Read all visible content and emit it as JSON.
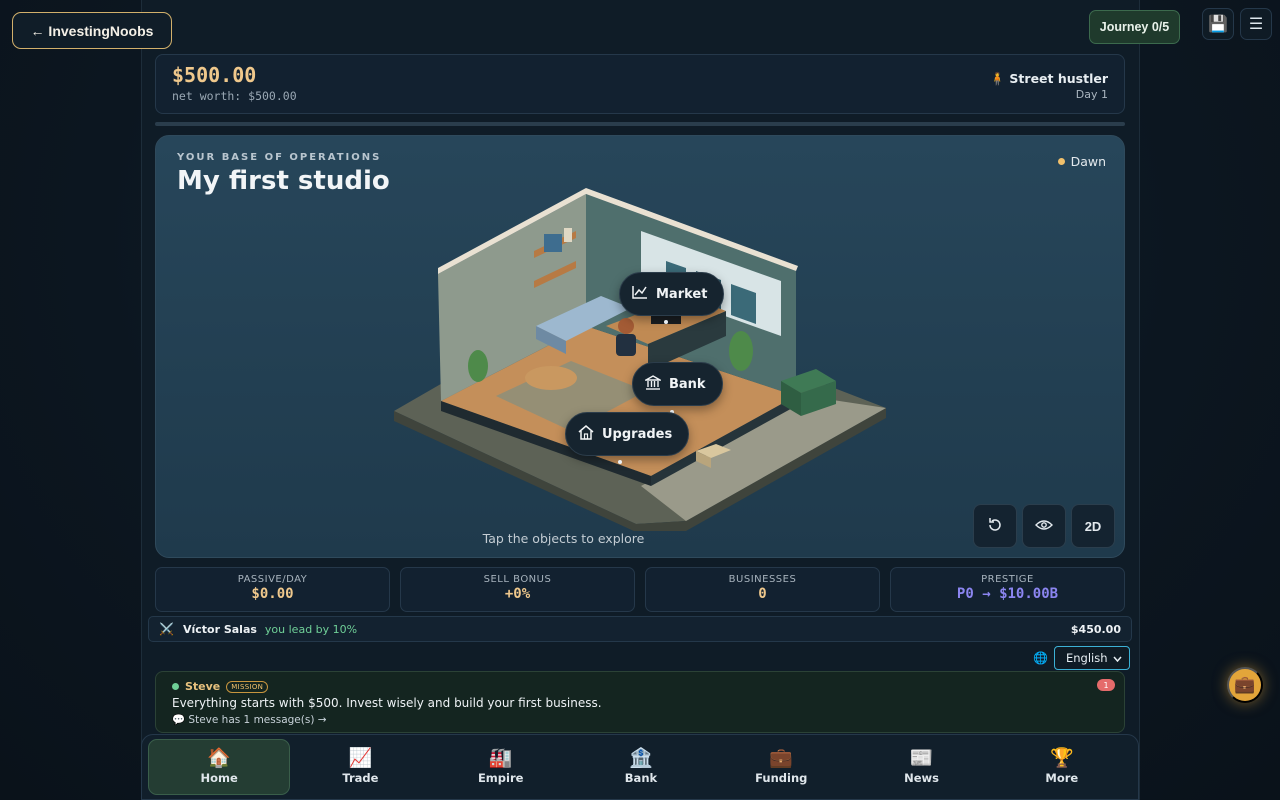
{
  "header": {
    "back_label": "← InvestingNoobs",
    "journey_label": "Journey 0/5",
    "save_icon": "💾",
    "menu_icon": "☰"
  },
  "balance": {
    "amount": "$500.00",
    "net_worth": "net worth: $500.00",
    "rank_label": "🧍 Street hustler",
    "day_label": "Day 1"
  },
  "scene": {
    "kicker": "YOUR BASE OF OPERATIONS",
    "title": "My first studio",
    "time_of_day": "Dawn",
    "hint": "Tap the objects to explore",
    "hotspots": {
      "market": "Market",
      "bank": "Bank",
      "upgrades": "Upgrades"
    },
    "view_toggle": "2D"
  },
  "stats": [
    {
      "label": "PASSIVE/DAY",
      "value": "$0.00",
      "color": "#efc88c"
    },
    {
      "label": "SELL BONUS",
      "value": "+0%",
      "color": "#efc88c"
    },
    {
      "label": "BUSINESSES",
      "value": "0",
      "color": "#efc88c"
    },
    {
      "label": "PRESTIGE",
      "value": "P0 → $10.00B",
      "color": "#8b85f0"
    }
  ],
  "rival": {
    "icon": "⚔️",
    "name": "Víctor Salas",
    "lead": "you lead by 10%",
    "net_worth": "$450.00"
  },
  "language": {
    "icon": "🌐",
    "selected": "English"
  },
  "message": {
    "sender": "Steve",
    "badge": "MISSION",
    "body": "Everything starts with $500. Invest wisely and build your first business.",
    "link": "💬 Steve has 1 message(s) →",
    "count": "1"
  },
  "nav": [
    {
      "icon": "🏠",
      "label": "Home"
    },
    {
      "icon": "📈",
      "label": "Trade"
    },
    {
      "icon": "🏭",
      "label": "Empire"
    },
    {
      "icon": "🏦",
      "label": "Bank"
    },
    {
      "icon": "💼",
      "label": "Funding"
    },
    {
      "icon": "📰",
      "label": "News"
    },
    {
      "icon": "🏆",
      "label": "More"
    }
  ],
  "fab_icon": "💼",
  "colors": {
    "accent_gold": "#efc88c",
    "prestige": "#8b85f0",
    "positive": "#6fcf97"
  }
}
